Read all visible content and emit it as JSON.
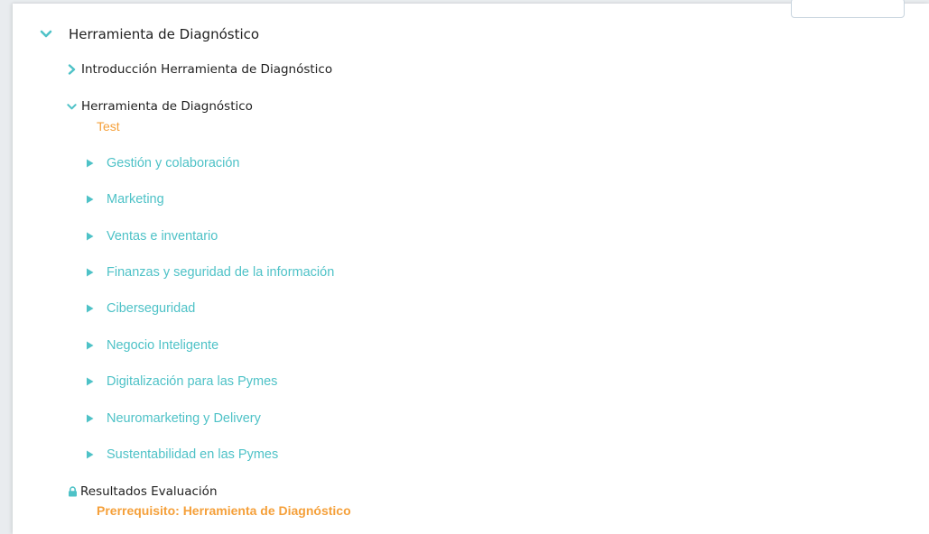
{
  "section": {
    "title": "Herramienta de Diagnóstico",
    "icon": "chevron-down-icon"
  },
  "intro": {
    "title": "Introducción Herramienta de Diagnóstico",
    "icon": "chevron-right-icon"
  },
  "tool": {
    "title": "Herramienta de Diagnóstico",
    "icon": "chevron-down-icon",
    "type_label": "Test"
  },
  "items": [
    {
      "label": "Gestión y colaboración",
      "completed": true
    },
    {
      "label": "Marketing",
      "completed": true
    },
    {
      "label": "Ventas e inventario",
      "completed": true
    },
    {
      "label": "Finanzas y seguridad de la información",
      "completed": true
    },
    {
      "label": "Ciberseguridad",
      "completed": true
    },
    {
      "label": "Negocio Inteligente",
      "completed": true
    },
    {
      "label": "Digitalización para las Pymes",
      "completed": true
    },
    {
      "label": "Neuromarketing y Delivery",
      "completed": true
    },
    {
      "label": "Sustentabilidad en las Pymes",
      "completed": false
    }
  ],
  "results": {
    "title": "Resultados Evaluación",
    "icon": "lock-icon",
    "prerequisite": "Prerrequisito: Herramienta de Diagnóstico"
  },
  "colors": {
    "accent_teal": "#4ec2c7",
    "accent_orange": "#f5a03a",
    "text_dark": "#1f1f1f"
  }
}
